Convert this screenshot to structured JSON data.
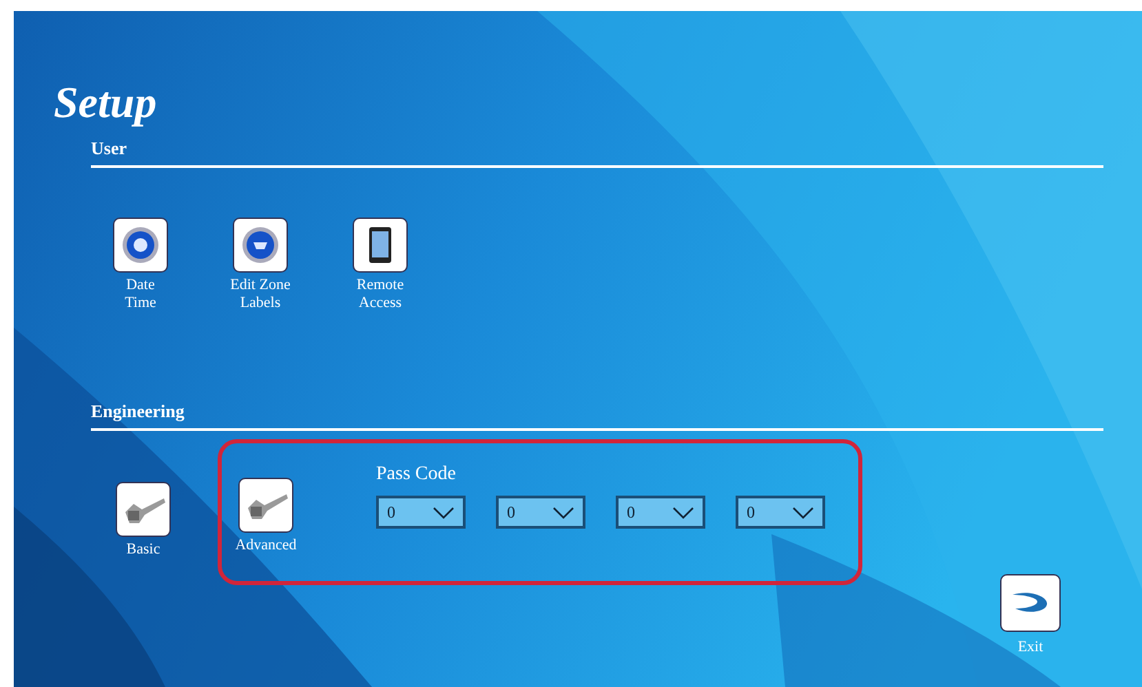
{
  "title": "Setup",
  "sections": [
    {
      "heading": "User",
      "items": [
        {
          "kind": "clock",
          "label": [
            "Date",
            "Time"
          ]
        },
        {
          "kind": "zone",
          "label": [
            "Edit Zone",
            "Labels"
          ]
        },
        {
          "kind": "phone",
          "label": [
            "Remote",
            "Access"
          ]
        }
      ]
    },
    {
      "heading": "Engineering",
      "items": [
        {
          "kind": "wrench",
          "label": [
            "Basic"
          ]
        },
        {
          "kind": "wrench",
          "label": [
            "Advanced"
          ]
        }
      ]
    }
  ],
  "pass_code": {
    "label": "Pass Code",
    "digits": [
      "0",
      "0",
      "0",
      "0"
    ]
  },
  "exit": {
    "label": "Exit"
  }
}
